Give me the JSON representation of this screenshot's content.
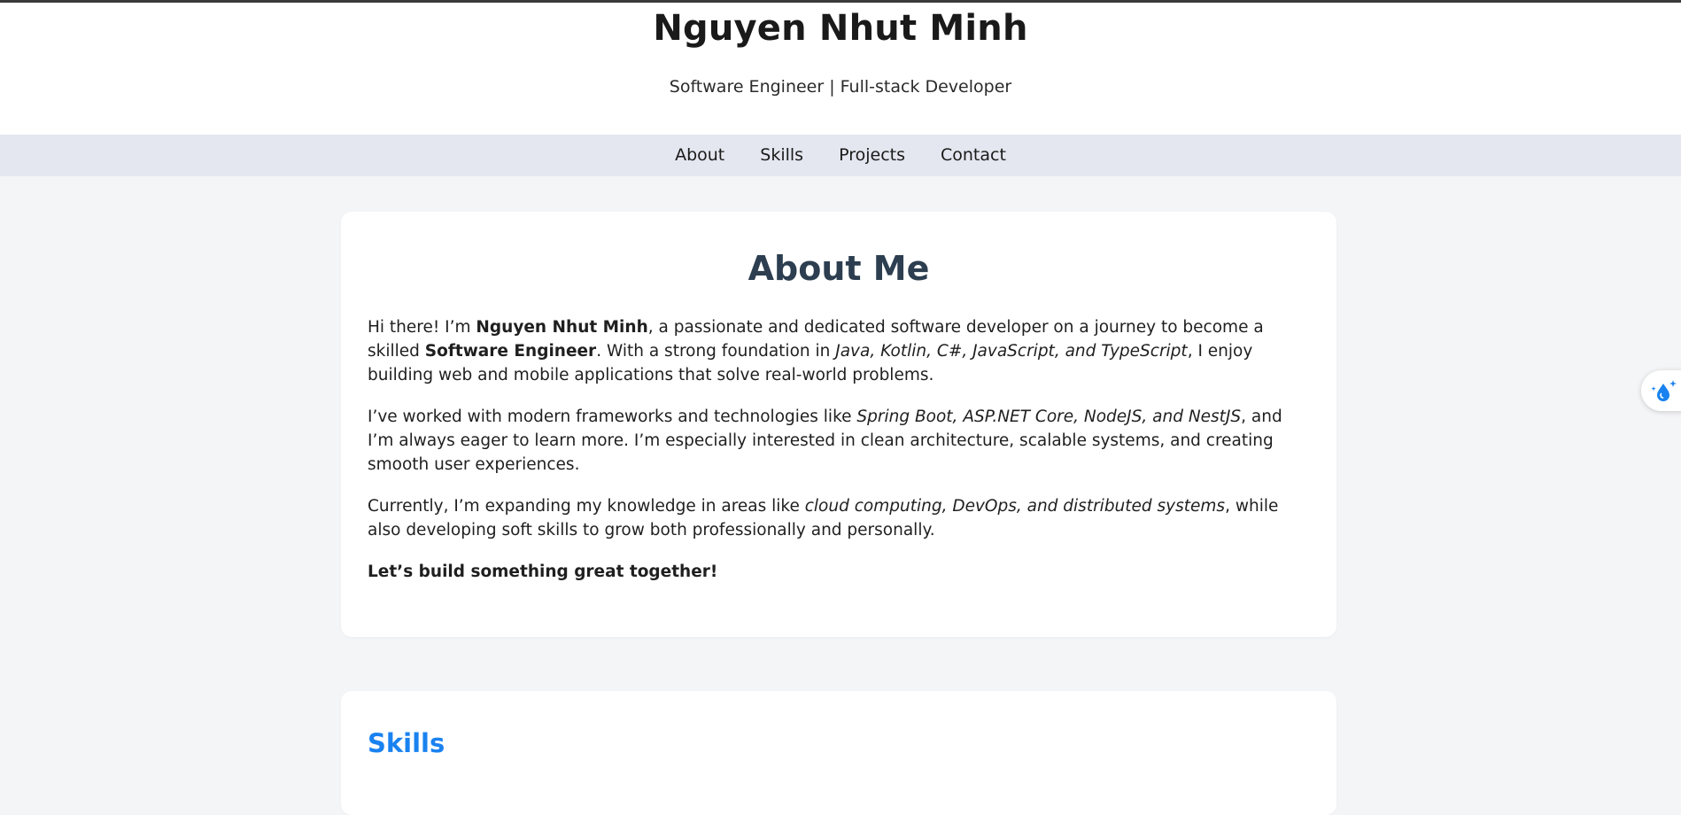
{
  "header": {
    "name": "Nguyen Nhut Minh",
    "subtitle": "Software Engineer | Full-stack Developer"
  },
  "nav": {
    "items": [
      {
        "label": "About"
      },
      {
        "label": "Skills"
      },
      {
        "label": "Projects"
      },
      {
        "label": "Contact"
      }
    ]
  },
  "about": {
    "heading": "About Me",
    "p1": {
      "t1": "Hi there! I’m ",
      "b1": "Nguyen Nhut Minh",
      "t2": ", a passionate and dedicated software developer on a journey to become a skilled ",
      "b2": "Software Engineer",
      "t3": ". With a strong foundation in ",
      "i1": "Java, Kotlin, C#, JavaScript, and TypeScript",
      "t4": ", I enjoy building web and mobile applications that solve real-world problems."
    },
    "p2": {
      "t1": "I’ve worked with modern frameworks and technologies like ",
      "i1": "Spring Boot, ASP.NET Core, NodeJS, and NestJS",
      "t2": ", and I’m always eager to learn more. I’m especially interested in clean architecture, scalable systems, and creating smooth user experiences."
    },
    "p3": {
      "t1": "Currently, I’m expanding my knowledge in areas like ",
      "i1": "cloud computing, DevOps, and distributed systems",
      "t2": ", while also developing soft skills to grow both professionally and personally."
    },
    "closing": "Let’s build something great together!"
  },
  "skills": {
    "heading": "Skills"
  },
  "widget": {
    "icon": "sparkle-drop-icon",
    "accent": "#1a82f0"
  },
  "colors": {
    "page_bg": "#f4f5f7",
    "nav_bg": "#e4e7ef",
    "about_heading": "#2c3e50",
    "skills_heading": "#1a82f0"
  }
}
